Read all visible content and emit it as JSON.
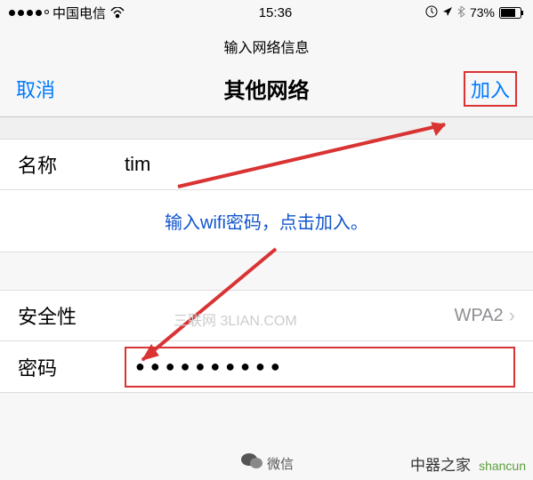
{
  "status": {
    "carrier": "中国电信",
    "time": "15:36",
    "battery_pct": "73%"
  },
  "header": {
    "subtitle": "输入网络信息",
    "cancel": "取消",
    "title": "其他网络",
    "join": "加入"
  },
  "form": {
    "name_label": "名称",
    "name_value": "tim",
    "security_label": "安全性",
    "security_value": "WPA2",
    "password_label": "密码",
    "password_value": "●●●●●●●●●●"
  },
  "annotation": {
    "text": "输入wifi密码，点击加入。"
  },
  "watermarks": {
    "w1": "三联网 3LIAN.COM",
    "w2": "中器之家",
    "w3": "shancun",
    "w4": "微信"
  }
}
